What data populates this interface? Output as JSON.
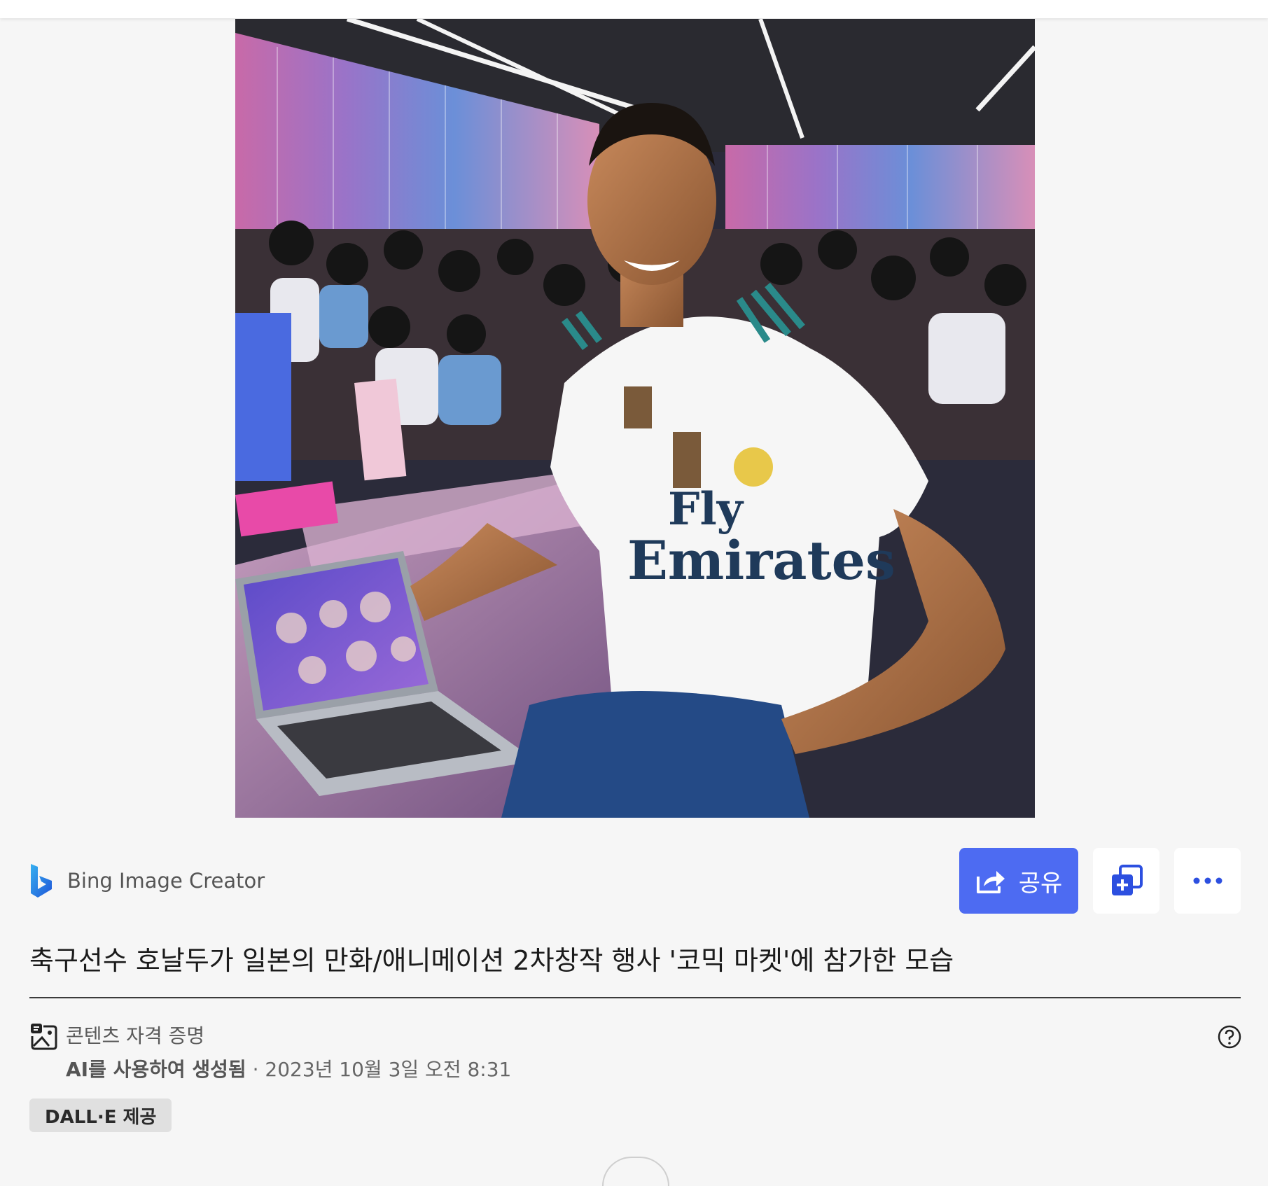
{
  "creator": {
    "name": "Bing Image Creator"
  },
  "actions": {
    "share_label": "공유"
  },
  "image": {
    "jersey_line1": "Fly",
    "jersey_line2": "Emirates"
  },
  "title": "축구선수 호날두가 일본의 만화/애니메이션 2차창작 행사 '코믹 마켓'에 참가한 모습",
  "credentials": {
    "label": "콘텐츠 자격 증명",
    "generated": "AI를 사용하여 생성됨",
    "separator": " · ",
    "timestamp": "2023년 10월 3일 오전 8:31"
  },
  "badge": {
    "label": "DALL·E 제공"
  },
  "colors": {
    "background": "#f6f6f6",
    "share_button": "#4d6bf2",
    "plain_button": "#ffffff",
    "badge_bg": "#e0e0e0",
    "divider": "#3b3b3b"
  },
  "icons": {
    "bing_logo": "bing-logo-icon",
    "share": "share-icon",
    "add_to_collection": "add-to-collection-icon",
    "more": "more-options-icon",
    "credentials": "content-credentials-icon",
    "help": "help-icon"
  }
}
